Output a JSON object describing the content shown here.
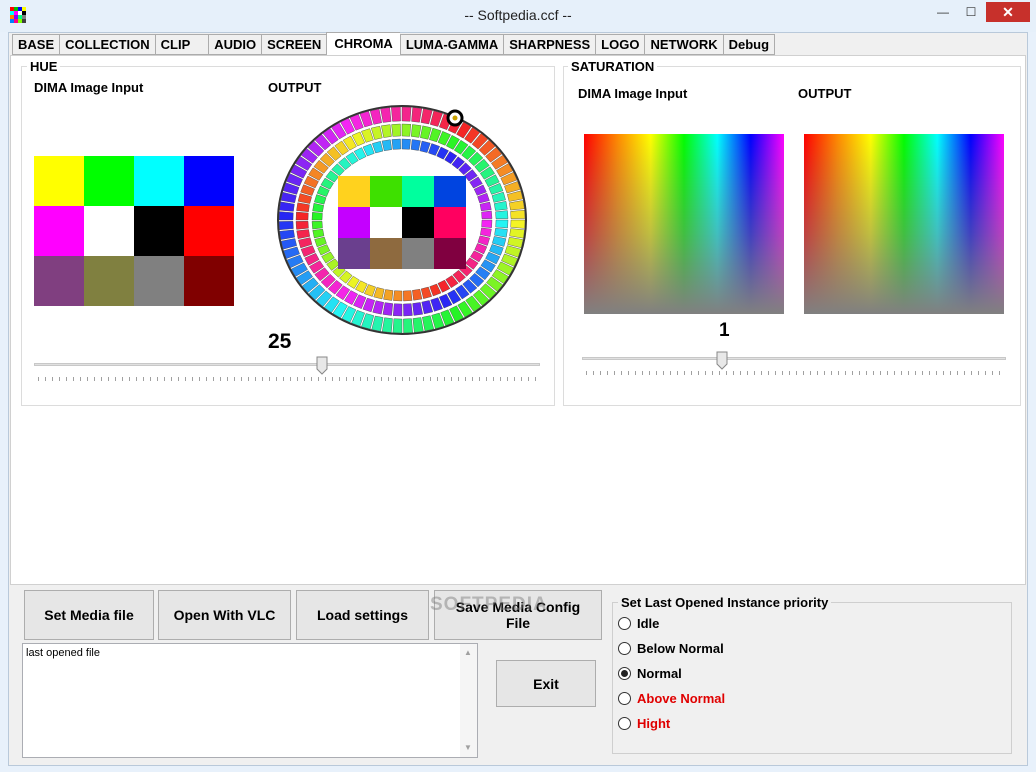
{
  "window": {
    "title": "-- Softpedia.ccf --",
    "minimize": "—",
    "maximize": "☐",
    "close": "✕"
  },
  "tabs": [
    {
      "label": "BASE"
    },
    {
      "label": "COLLECTION"
    },
    {
      "label": "CLIP"
    },
    {
      "label": "AUDIO"
    },
    {
      "label": "SCREEN"
    },
    {
      "label": "CHROMA",
      "active": true
    },
    {
      "label": "LUMA-GAMMA"
    },
    {
      "label": "SHARPNESS"
    },
    {
      "label": "LOGO"
    },
    {
      "label": "NETWORK"
    },
    {
      "label": "Debug"
    }
  ],
  "hue": {
    "title": "HUE",
    "input_label": "DIMA Image Input",
    "output_label": "OUTPUT",
    "value": "25",
    "slider_fraction": 0.57,
    "input_swatches": [
      "#ffff00",
      "#00ff00",
      "#00ffff",
      "#0000ff",
      "#ff00ff",
      "#ffffff",
      "#000000",
      "#ff0000",
      "#803f80",
      "#808040",
      "#808080",
      "#800000"
    ],
    "output_swatches": [
      "#ffd21e",
      "#3ee000",
      "#00ff9e",
      "#0044e0",
      "#c400ff",
      "#ffffff",
      "#000000",
      "#ff0060",
      "#6a3f8e",
      "#8e6a3f",
      "#808080",
      "#800040"
    ]
  },
  "saturation": {
    "title": "SATURATION",
    "input_label": "DIMA Image Input",
    "output_label": "OUTPUT",
    "value": "1",
    "slider_fraction": 0.33
  },
  "buttons": {
    "set_media": "Set Media file",
    "open_vlc": "Open With VLC",
    "load_settings": "Load settings",
    "save_config": "Save Media Config File",
    "exit": "Exit"
  },
  "last_opened": {
    "text": "last opened file"
  },
  "priority": {
    "title": "Set Last Opened Instance priority",
    "options": [
      {
        "label": "Idle",
        "color": "#000000",
        "selected": false
      },
      {
        "label": "Below Normal",
        "color": "#000000",
        "selected": false
      },
      {
        "label": "Normal",
        "color": "#000000",
        "selected": true
      },
      {
        "label": "Above Normal",
        "color": "#e00000",
        "selected": false
      },
      {
        "label": "Hight",
        "color": "#e00000",
        "selected": false
      }
    ]
  },
  "icons": {
    "app": "palette-grid-icon",
    "scroll_up": "▲",
    "scroll_down": "▼"
  },
  "watermark": "SOFTPEDIA"
}
